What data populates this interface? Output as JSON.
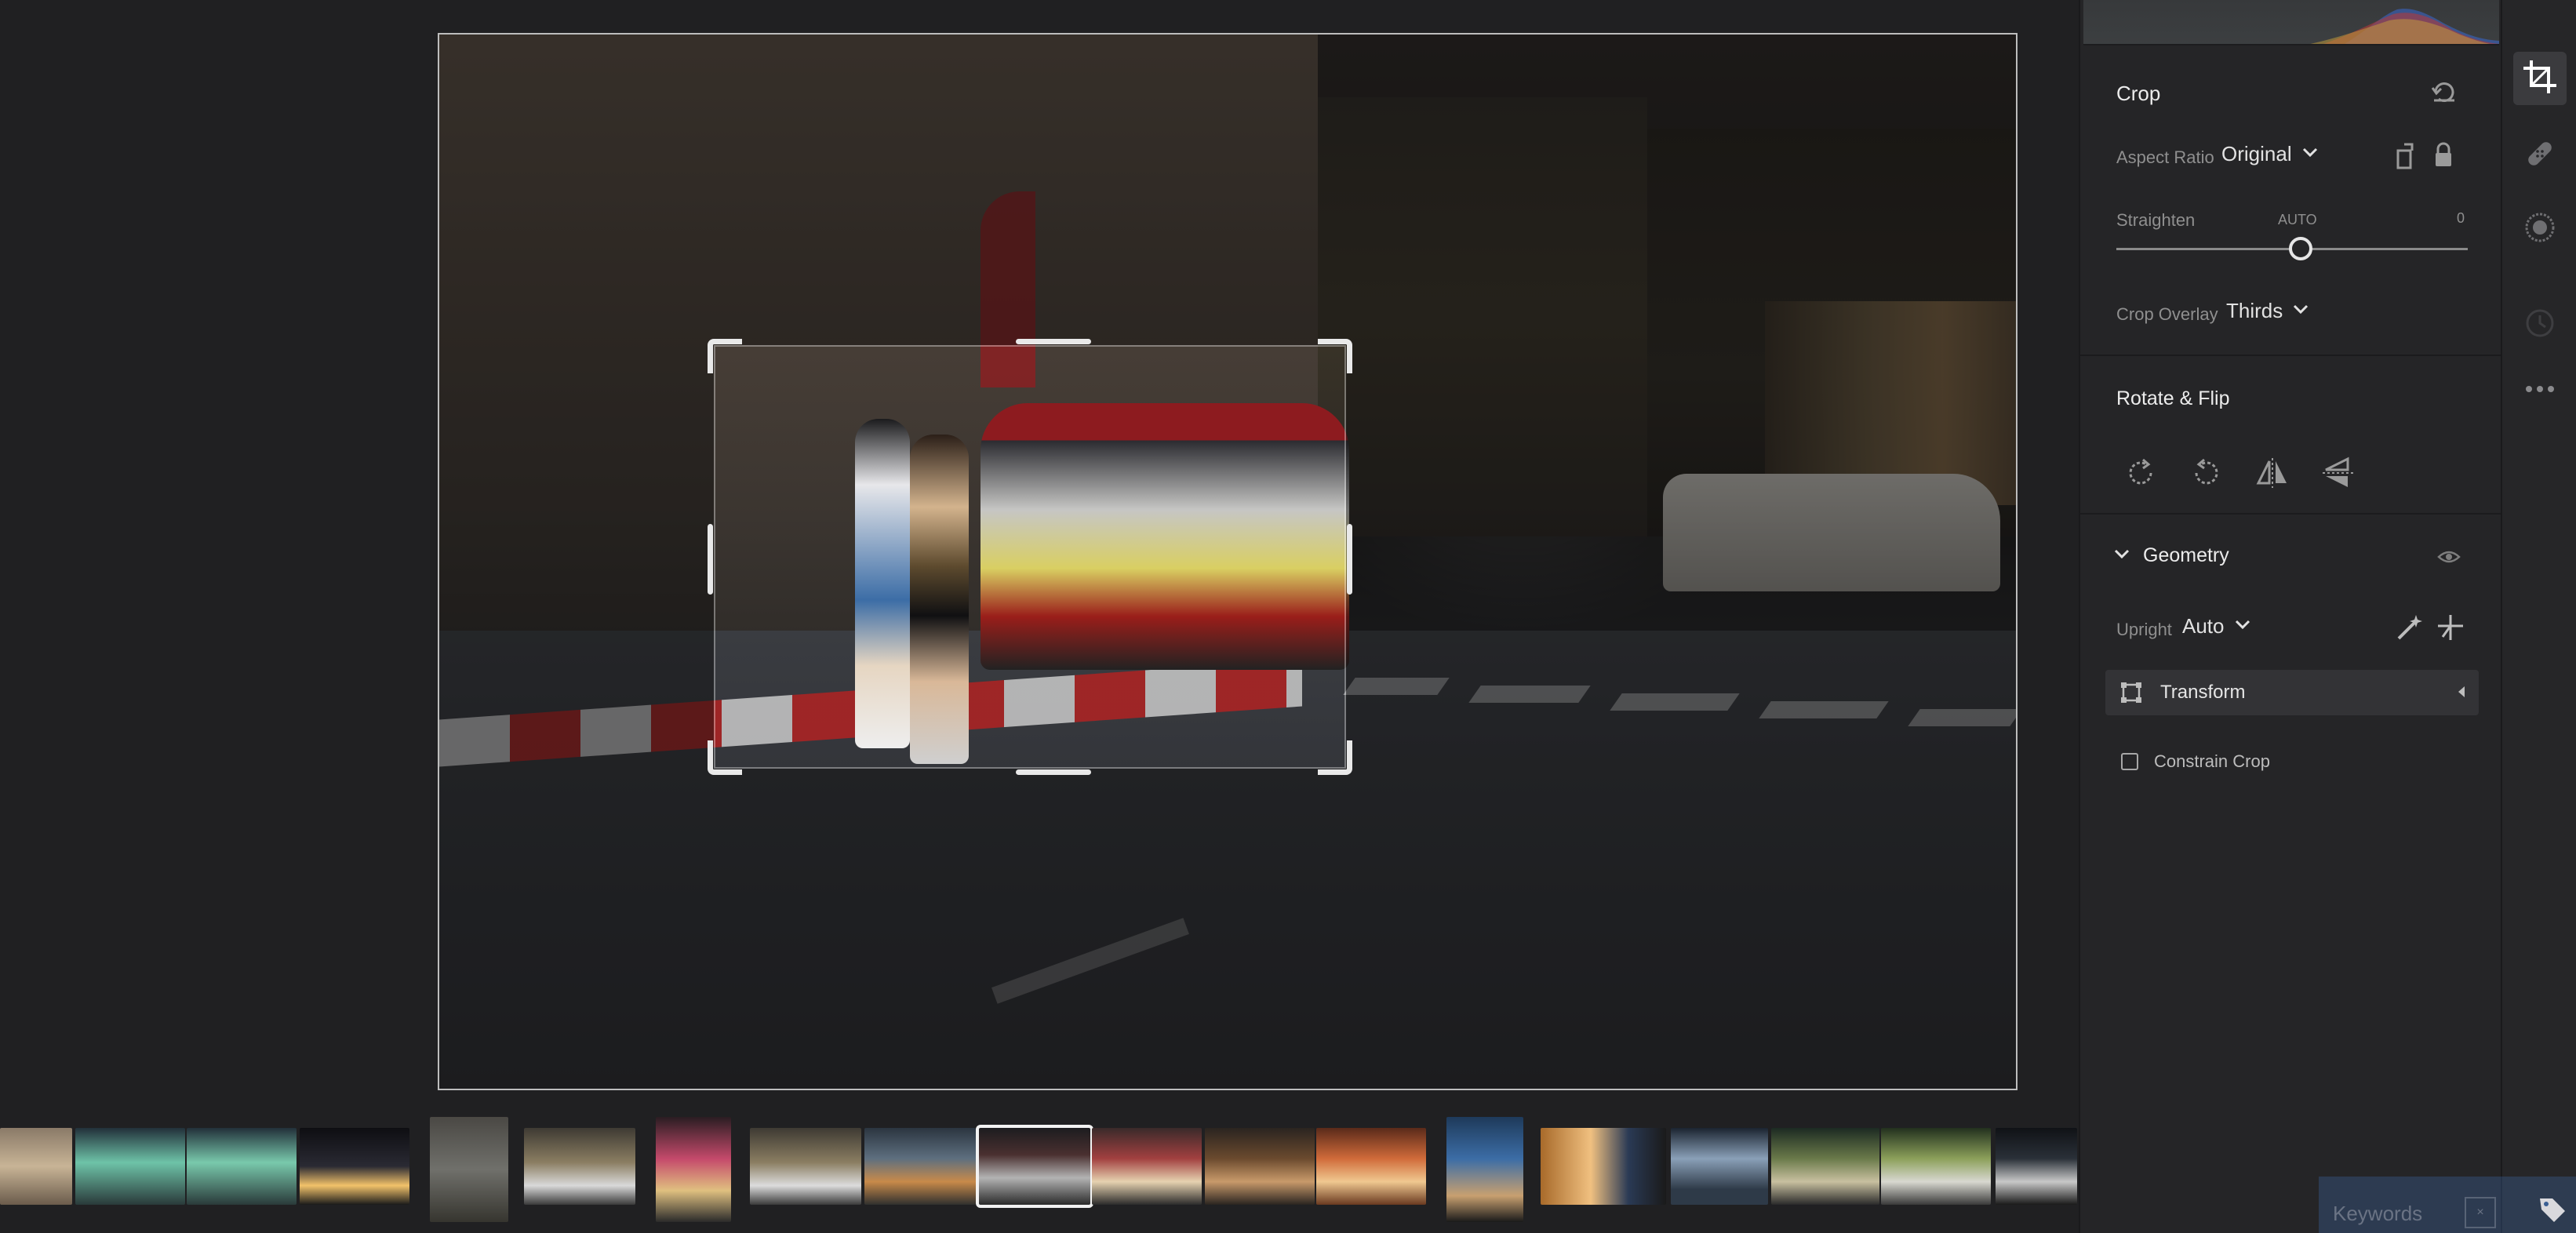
{
  "crop": {
    "title": "Crop",
    "aspect_ratio_label": "Aspect Ratio",
    "aspect_ratio_value": "Original",
    "straighten_label": "Straighten",
    "straighten_mode": "AUTO",
    "straighten_value": "0",
    "crop_overlay_label": "Crop Overlay",
    "crop_overlay_value": "Thirds"
  },
  "rotate_flip": {
    "title": "Rotate & Flip"
  },
  "geometry": {
    "title": "Geometry",
    "upright_label": "Upright",
    "upright_value": "Auto",
    "transform_label": "Transform",
    "constrain_crop_label": "Constrain Crop"
  },
  "keywords": {
    "label": "Keywords"
  },
  "filmstrip": {
    "thumbnails": [
      {
        "name": "portrait-mural",
        "selected": false
      },
      {
        "name": "green-building",
        "selected": false
      },
      {
        "name": "green-building-2",
        "selected": false
      },
      {
        "name": "night-street",
        "selected": false
      },
      {
        "name": "wall-figure",
        "selected": false
      },
      {
        "name": "street-car",
        "selected": false
      },
      {
        "name": "neon-stall",
        "selected": false
      },
      {
        "name": "street-car-2",
        "selected": false
      },
      {
        "name": "market-vendor",
        "selected": false
      },
      {
        "name": "food-cart-night",
        "selected": true
      },
      {
        "name": "food-cart-2",
        "selected": false
      },
      {
        "name": "food-cart-3",
        "selected": false
      },
      {
        "name": "grilled-skewers",
        "selected": false
      },
      {
        "name": "hands-cooking",
        "selected": false
      },
      {
        "name": "grill-closeup",
        "selected": false
      },
      {
        "name": "smoke-grill",
        "selected": false
      },
      {
        "name": "night-market",
        "selected": false
      },
      {
        "name": "street-truck",
        "selected": false
      },
      {
        "name": "dark-street",
        "selected": false
      }
    ]
  },
  "colors": {
    "panel_bg": "#252527",
    "app_bg": "#202022",
    "accent_selected": "#f2f2f2"
  },
  "icons": {
    "reset": "reset-icon",
    "rotate_cw": "rotate-clockwise-icon",
    "rotate_ccw": "rotate-counterclockwise-icon",
    "flip_h": "flip-horizontal-icon",
    "flip_v": "flip-vertical-icon"
  }
}
